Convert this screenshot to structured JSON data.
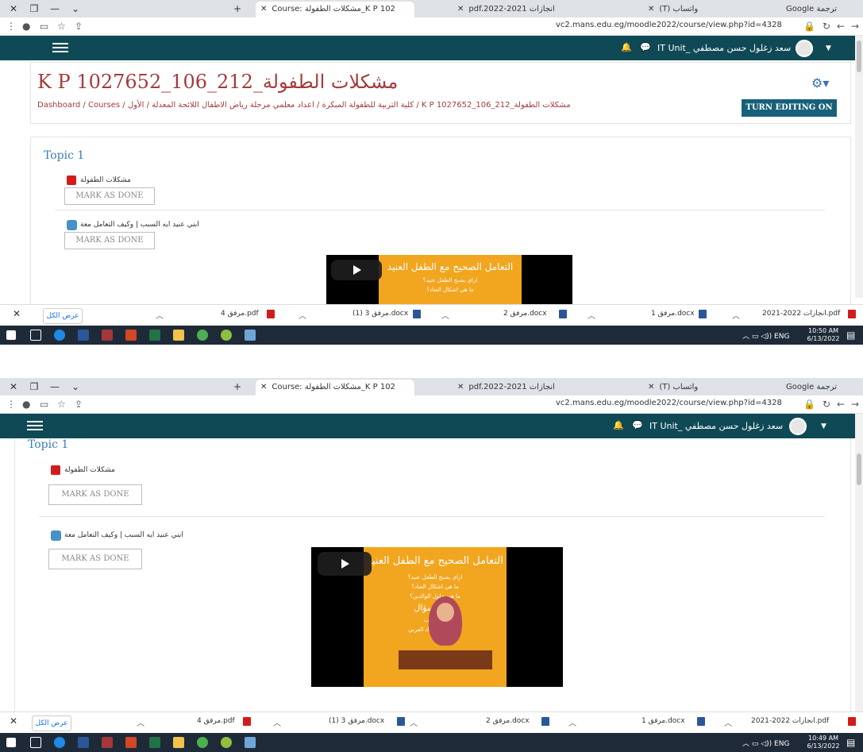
{
  "browser": {
    "tabs": [
      {
        "label": "Course: مشكلات الطفولة_K P 102"
      },
      {
        "label": "pdf.2022-2021 انجازات"
      },
      {
        "label": "(T) واتساب"
      },
      {
        "label": "Google ترجمة"
      }
    ],
    "new_tab": "+",
    "url": "vc2.mans.edu.eg/moodle2022/course/view.php?id=4328"
  },
  "navbar": {
    "user_name": "IT Unit_ سعد زغلول حسن مصطفي"
  },
  "course": {
    "title": "K P 1027652_106_212_مشكلات الطفولة",
    "breadcrumb": "Dashboard / Courses / كلية التربية للطفولة المبكرة / اعداد معلمي مرحلة رياض الاطفال اللائحة المعدلة / الأول / K P 1027652_106_212_مشكلات الطفولة",
    "edit_button": "TURN EDITING ON"
  },
  "section": {
    "topic_title": "Topic 1",
    "activities": [
      {
        "name": "مشكلات الطفولة",
        "type": "pdf-icon",
        "button": "MARK AS DONE"
      },
      {
        "name": "ابني عنيد ايه السبب | وكيف التعامل معة",
        "type": "url-icon",
        "button": "MARK AS DONE"
      }
    ],
    "video": {
      "title": "التعامل الصحيح مع الطفل العنيد",
      "lines": [
        "ازاي يصبح الطفل عنيد؟",
        "ما هي اشكال العناد؟",
        "ما هي حلول الوالدين؟",
        "كل سؤال ..",
        "وله جواب",
        "مع الدكتورة نهاد العربي"
      ]
    }
  },
  "downloads": {
    "items": [
      {
        "name": "انجازات 2022-2021.pdf",
        "type": "pdf"
      },
      {
        "name": "مرفق 1.docx",
        "type": "docx"
      },
      {
        "name": "مرفق 2.docx",
        "type": "docx"
      },
      {
        "name": "مرفق 3 (1).docx",
        "type": "docx"
      },
      {
        "name": "مرفق 4.pdf",
        "type": "pdf"
      }
    ],
    "show_all": "عرض الكل"
  },
  "taskbar": {
    "lang": "ENG",
    "screenshot1": {
      "time": "10:50 AM",
      "date": "6/13/2022"
    },
    "screenshot2": {
      "time": "10:49 AM",
      "date": "6/13/2022"
    }
  },
  "colors": {
    "navbar": "#0f4956",
    "title": "#a53b3b",
    "topic": "#3a7bbd",
    "edit_button": "#17607a",
    "video_orange": "#f2a51e"
  }
}
